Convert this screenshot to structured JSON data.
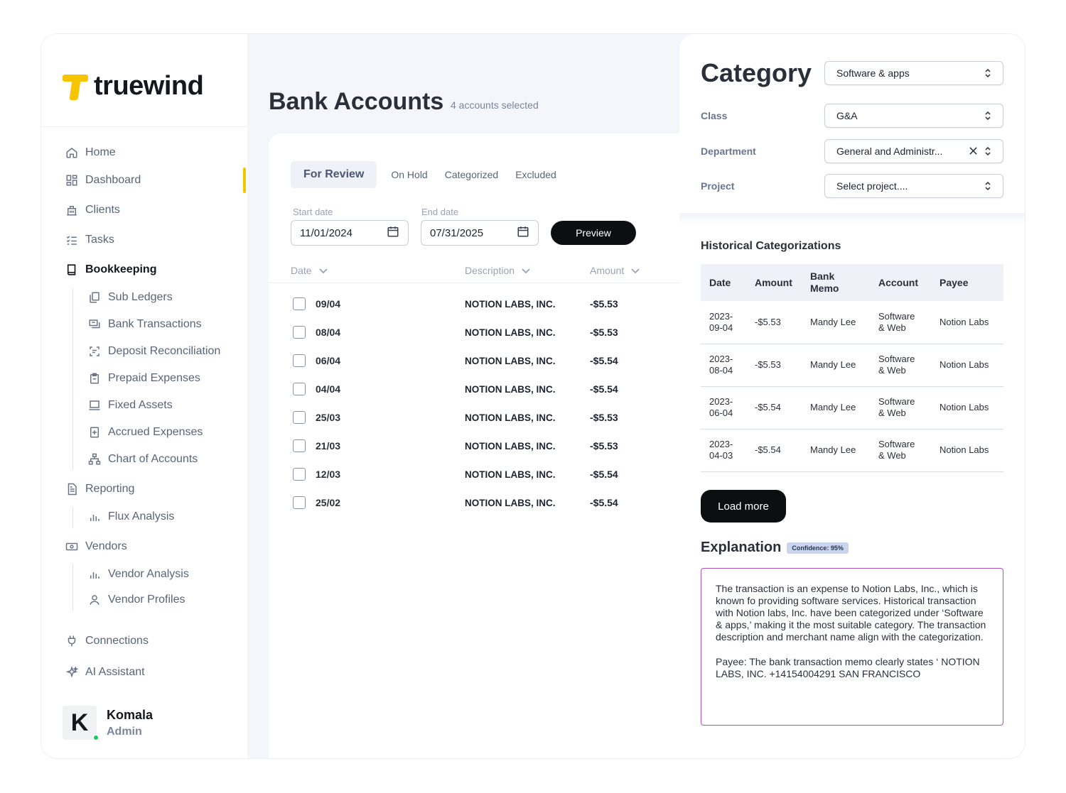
{
  "brand": {
    "name": "truewind",
    "accent": "#f7c500"
  },
  "sidebar": {
    "items": [
      {
        "label": "Home",
        "icon": "home-icon"
      },
      {
        "label": "Dashboard",
        "icon": "dashboard-icon"
      },
      {
        "label": "Clients",
        "icon": "building-icon"
      },
      {
        "label": "Tasks",
        "icon": "checklist-icon"
      },
      {
        "label": "Bookkeeping",
        "icon": "book-icon"
      },
      {
        "label": "Reporting",
        "icon": "report-icon"
      },
      {
        "label": "Vendors",
        "icon": "cash-icon"
      },
      {
        "label": "Connections",
        "icon": "plug-icon"
      },
      {
        "label": "AI Assistant",
        "icon": "sparkle-icon"
      }
    ],
    "bookkeeping_sub": [
      {
        "label": "Sub Ledgers",
        "icon": "copy-icon"
      },
      {
        "label": "Bank Transactions",
        "icon": "transactions-icon"
      },
      {
        "label": "Deposit Reconciliation",
        "icon": "scan-icon"
      },
      {
        "label": "Prepaid Expenses",
        "icon": "clipboard-icon"
      },
      {
        "label": "Fixed Assets",
        "icon": "laptop-icon"
      },
      {
        "label": "Accrued Expenses",
        "icon": "plus-box-icon"
      },
      {
        "label": "Chart of Accounts",
        "icon": "hierarchy-icon"
      }
    ],
    "reporting_sub": [
      {
        "label": "Flux Analysis",
        "icon": "bar-chart-icon"
      }
    ],
    "vendors_sub": [
      {
        "label": "Vendor Analysis",
        "icon": "bar-chart-icon"
      },
      {
        "label": "Vendor Profiles",
        "icon": "user-icon"
      }
    ],
    "user": {
      "initial": "K",
      "name": "Komala",
      "role": "Admin"
    }
  },
  "main": {
    "title": "Bank Accounts",
    "subtitle": "4 accounts selected",
    "tabs": [
      "For Review",
      "On Hold",
      "Categorized",
      "Excluded"
    ],
    "start_date": {
      "label": "Start date",
      "value": "11/01/2024"
    },
    "end_date": {
      "label": "End date",
      "value": "07/31/2025"
    },
    "preview_label": "Preview",
    "columns": {
      "date": "Date",
      "description": "Description",
      "amount": "Amount"
    },
    "rows": [
      {
        "date": "09/04",
        "description": "NOTION LABS, INC.",
        "amount": "-$5.53"
      },
      {
        "date": "08/04",
        "description": "NOTION LABS, INC.",
        "amount": "-$5.53"
      },
      {
        "date": "06/04",
        "description": "NOTION LABS, INC.",
        "amount": "-$5.54"
      },
      {
        "date": "04/04",
        "description": "NOTION LABS, INC.",
        "amount": "-$5.54"
      },
      {
        "date": "25/03",
        "description": "NOTION LABS, INC.",
        "amount": "-$5.53"
      },
      {
        "date": "21/03",
        "description": "NOTION LABS, INC.",
        "amount": "-$5.53"
      },
      {
        "date": "12/03",
        "description": "NOTION LABS, INC.",
        "amount": "-$5.54"
      },
      {
        "date": "25/02",
        "description": "NOTION LABS, INC.",
        "amount": "-$5.54"
      }
    ]
  },
  "detail": {
    "category_title": "Category",
    "category_value": "Software & apps",
    "class_label": "Class",
    "class_value": "G&A",
    "department_label": "Department",
    "department_value": "General and Administr...",
    "project_label": "Project",
    "project_placeholder": "Select project....",
    "history_title": "Historical Categorizations",
    "history_columns": [
      "Date",
      "Amount",
      "Bank Memo",
      "Account",
      "Payee"
    ],
    "history_rows": [
      {
        "date": "2023-09-04",
        "amount": "-$5.53",
        "memo": "Mandy Lee",
        "account": "Software & Web",
        "payee": "Notion Labs"
      },
      {
        "date": "2023-08-04",
        "amount": "-$5.53",
        "memo": "Mandy Lee",
        "account": "Software & Web",
        "payee": "Notion Labs"
      },
      {
        "date": "2023-06-04",
        "amount": "-$5.54",
        "memo": "Mandy Lee",
        "account": "Software & Web",
        "payee": "Notion Labs"
      },
      {
        "date": "2023-04-03",
        "amount": "-$5.54",
        "memo": "Mandy Lee",
        "account": "Software & Web",
        "payee": "Notion Labs"
      }
    ],
    "load_more_label": "Load more",
    "explanation_title": "Explanation",
    "confidence": "Confidence: 95%",
    "explanation_p1": "The transaction is an expense to Notion Labs, Inc., which is known fo providing software services. Historical transaction with Notion labs, Inc. have been categorized under ‘Software & apps,’ making it the most suitable category. The transaction description and merchant name align with the categorization.",
    "explanation_p2": "Payee: The bank transaction memo clearly states ‘ NOTION LABS, INC. +14154004291 SAN FRANCISCO"
  }
}
